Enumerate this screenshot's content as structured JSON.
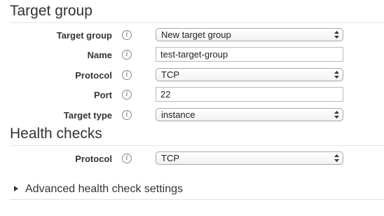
{
  "target_group": {
    "title": "Target group",
    "fields": {
      "target_group": {
        "label": "Target group",
        "info": "i",
        "value": "New target group"
      },
      "name": {
        "label": "Name",
        "info": "i",
        "value": "test-target-group"
      },
      "protocol": {
        "label": "Protocol",
        "info": "i",
        "value": "TCP"
      },
      "port": {
        "label": "Port",
        "info": "i",
        "value": "22"
      },
      "target_type": {
        "label": "Target type",
        "info": "i",
        "value": "instance"
      }
    }
  },
  "health_checks": {
    "title": "Health checks",
    "fields": {
      "protocol": {
        "label": "Protocol",
        "info": "i",
        "value": "TCP"
      }
    }
  },
  "advanced": {
    "label": "Advanced health check settings",
    "icon": "caret-right-icon"
  }
}
